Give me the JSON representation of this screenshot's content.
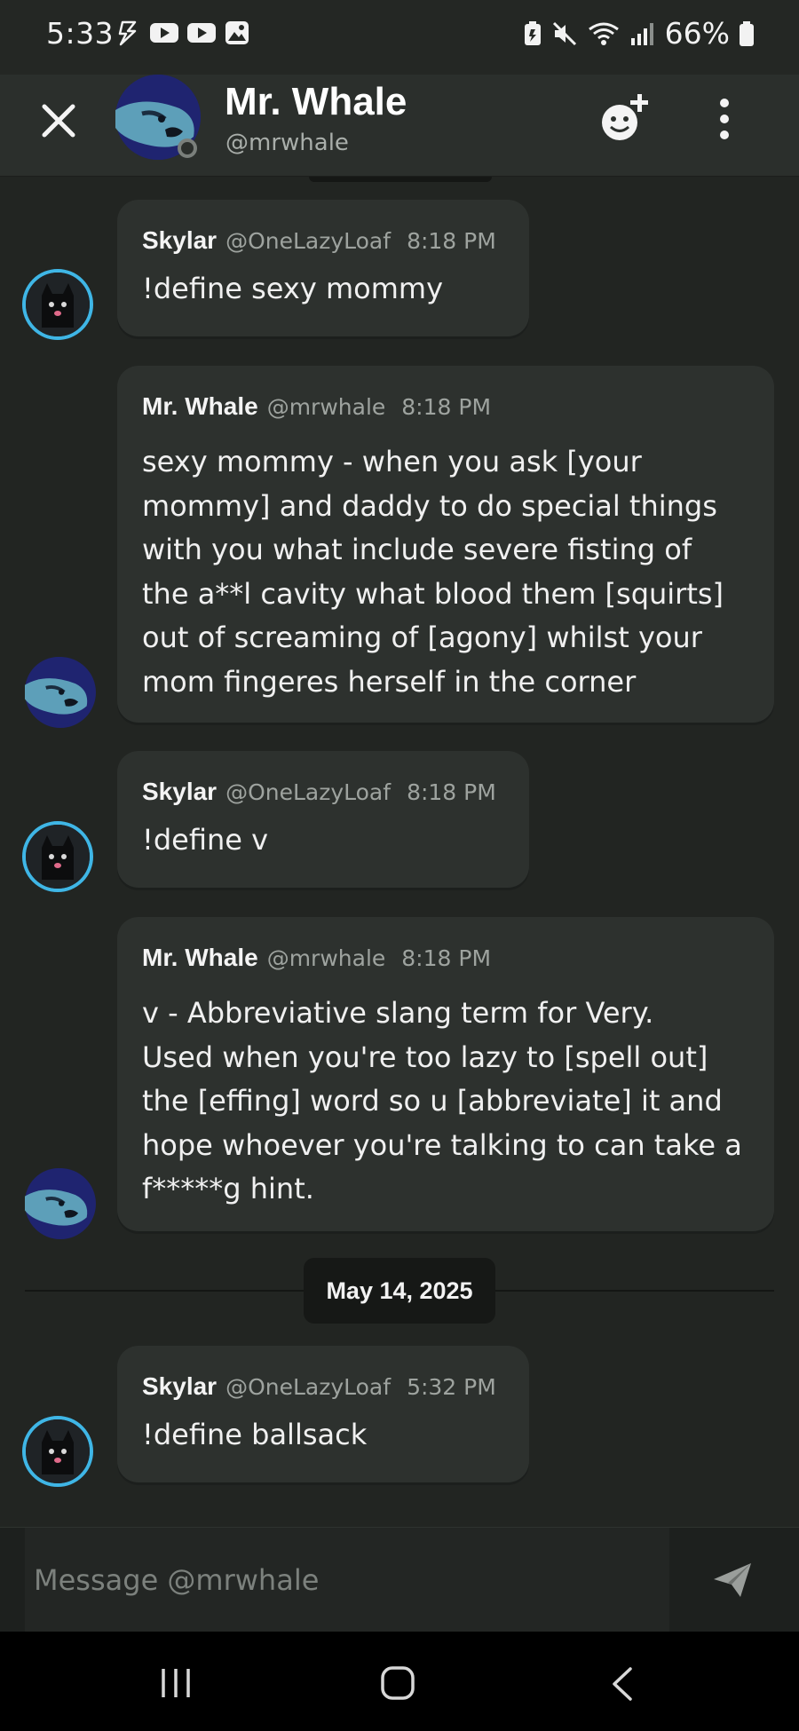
{
  "status_bar": {
    "time": "5:33",
    "left_icons": [
      "flash-icon",
      "youtube-icon",
      "youtube-icon",
      "gallery-icon"
    ],
    "right_icons": [
      "battery-saver-icon",
      "mute-icon",
      "wifi-icon",
      "signal-icon"
    ],
    "battery": "66%"
  },
  "header": {
    "name": "Mr. Whale",
    "handle": "@mrwhale",
    "close_icon": "close-icon",
    "add_reaction_icon": "emoji-add-icon",
    "more_icon": "more-vertical-icon"
  },
  "messages": [
    {
      "author": "Skylar",
      "handle": "@OneLazyLoaf",
      "time": "8:18 PM",
      "text": "!define sexy mommy",
      "avatar": "cat"
    },
    {
      "author": "Mr. Whale",
      "handle": "@mrwhale",
      "time": "8:18 PM",
      "text": "sexy mommy - when you ask [your\nmommy] and daddy to do special things\nwith you what include severe fisting of\nthe a**l cavity what blood them [squirts]\nout of screaming of [agony] whilst your\nmom fingeres herself in the corner",
      "avatar": "whale"
    },
    {
      "author": "Skylar",
      "handle": "@OneLazyLoaf",
      "time": "8:18 PM",
      "text": "!define v",
      "avatar": "cat"
    },
    {
      "author": "Mr. Whale",
      "handle": "@mrwhale",
      "time": "8:18 PM",
      "text": "v - Abbreviative slang term for Very.\nUsed when you're too lazy to [spell out]\nthe [effing] word so u [abbreviate] it and\nhope whoever you're talking to can take a\nf*****g hint.",
      "avatar": "whale"
    },
    {
      "author": "Skylar",
      "handle": "@OneLazyLoaf",
      "time": "5:32 PM",
      "text": "!define ballsack",
      "avatar": "cat"
    }
  ],
  "date_divider": "May 14, 2025",
  "composer": {
    "placeholder": "Message @mrwhale",
    "send_icon": "send-icon"
  },
  "nav_bar": {
    "icons": [
      "recents-icon",
      "home-icon",
      "back-icon"
    ]
  },
  "colors": {
    "background": "#222522",
    "bubble": "#2d312e",
    "header": "#2b2f2c",
    "cat_ring": "#3fb6e6",
    "whale_bg": "#1f2470"
  }
}
